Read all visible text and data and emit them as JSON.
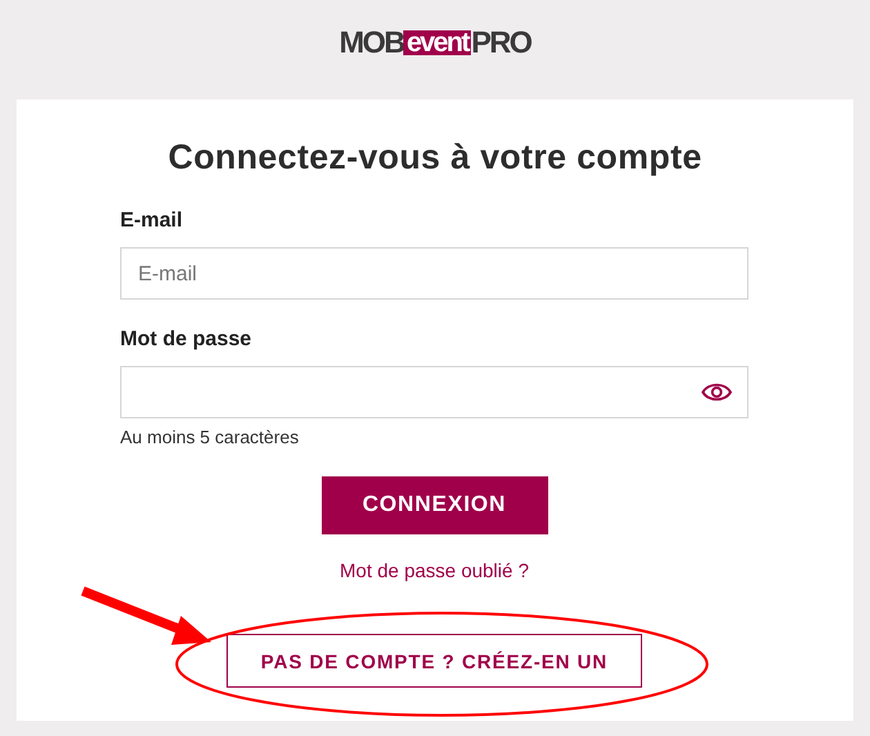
{
  "logo": {
    "left": "MOB",
    "highlight": "event",
    "right": "PRO"
  },
  "title": "Connectez-vous à votre compte",
  "fields": [
    {
      "label": "E-mail",
      "placeholder": "E-mail",
      "kind": "text"
    },
    {
      "label": "Mot de passe",
      "kind": "password",
      "hint": "Au moins 5 caractères"
    }
  ],
  "submit_button": "CONNEXION",
  "forgot_link": "Mot de passe oublié ?",
  "signup_button": "PAS DE COMPTE ? CRÉEZ-EN UN"
}
